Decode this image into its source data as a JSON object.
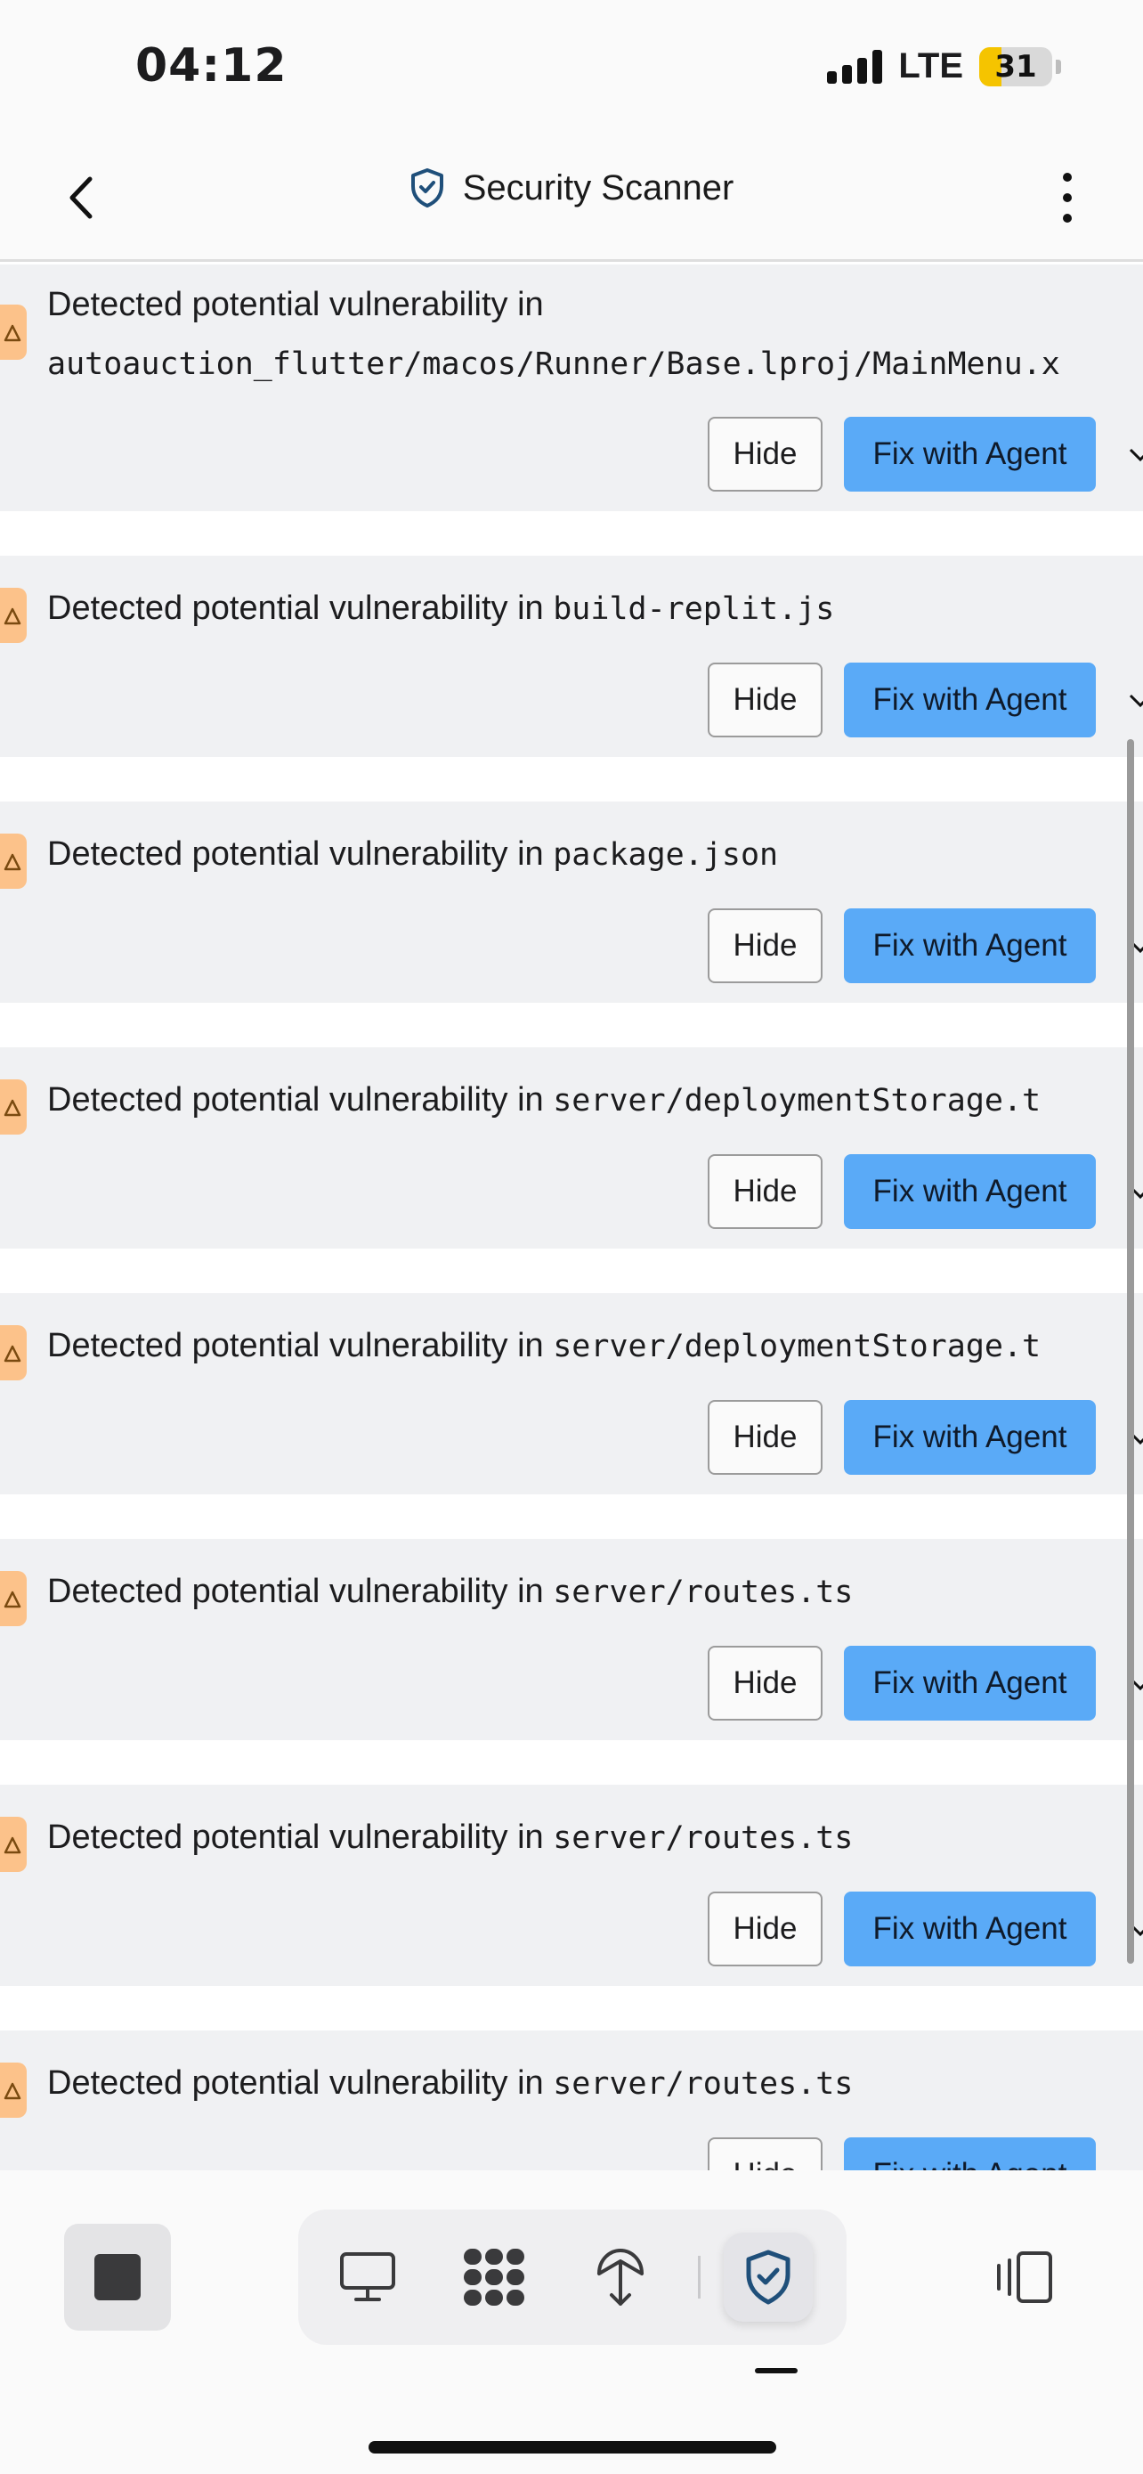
{
  "status_bar": {
    "time": "04:12",
    "network": "LTE",
    "battery": "31"
  },
  "header": {
    "title": "Security Scanner",
    "title_icon": "shield-check-icon",
    "back_icon": "chevron-left-icon",
    "menu_icon": "more-vertical-icon"
  },
  "vulnerabilities": [
    {
      "prefix": "Detected potential vulnerability in",
      "file": "autoauction_flutter/macos/Runner/Base.lproj/MainMenu.x",
      "hide_label": "Hide",
      "fix_label": "Fix with Agent"
    },
    {
      "prefix": "Detected potential vulnerability in",
      "file": "build-replit.js",
      "hide_label": "Hide",
      "fix_label": "Fix with Agent"
    },
    {
      "prefix": "Detected potential vulnerability in",
      "file": "package.json",
      "hide_label": "Hide",
      "fix_label": "Fix with Agent"
    },
    {
      "prefix": "Detected potential vulnerability in",
      "file": "server/deploymentStorage.t",
      "hide_label": "Hide",
      "fix_label": "Fix with Agent"
    },
    {
      "prefix": "Detected potential vulnerability in",
      "file": "server/deploymentStorage.t",
      "hide_label": "Hide",
      "fix_label": "Fix with Agent"
    },
    {
      "prefix": "Detected potential vulnerability in",
      "file": "server/routes.ts",
      "hide_label": "Hide",
      "fix_label": "Fix with Agent"
    },
    {
      "prefix": "Detected potential vulnerability in",
      "file": "server/routes.ts",
      "hide_label": "Hide",
      "fix_label": "Fix with Agent"
    },
    {
      "prefix": "Detected potential vulnerability in",
      "file": "server/routes.ts",
      "hide_label": "Hide",
      "fix_label": "Fix with Agent"
    }
  ],
  "bottom_bar": {
    "stop_icon": "stop-icon",
    "tools": [
      "monitor-icon",
      "workflow-icon",
      "deployment-icon",
      "shield-check-icon"
    ],
    "active_tool": "shield-check-icon",
    "panel_icon": "panel-switch-icon"
  },
  "colors": {
    "accent": "#5aaaf7",
    "warning": "#fcc28a",
    "card_bg": "#f0f1f3",
    "shield": "#1f4f7a"
  }
}
